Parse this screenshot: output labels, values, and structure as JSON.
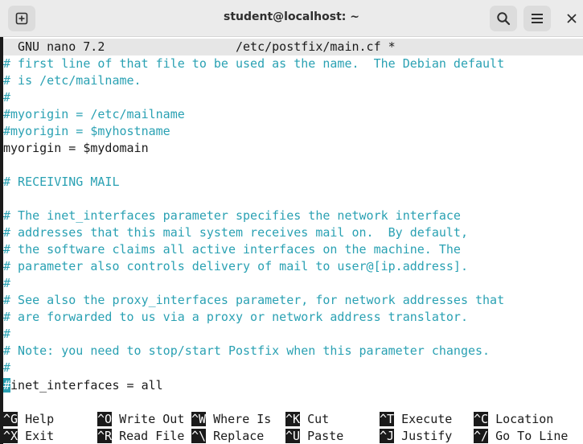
{
  "window": {
    "title": "student@localhost: ~",
    "icons": {
      "new_tab": "new-tab-icon",
      "search": "search-icon",
      "menu": "hamburger-menu-icon",
      "close": "close-icon"
    }
  },
  "nano": {
    "app_version": "GNU nano 7.2",
    "file_title": "/etc/postfix/main.cf *"
  },
  "lines": [
    {
      "text": "# first line of that file to be used as the name.  The Debian default",
      "kind": "comment"
    },
    {
      "text": "# is /etc/mailname.",
      "kind": "comment"
    },
    {
      "text": "#",
      "kind": "comment"
    },
    {
      "text": "#myorigin = /etc/mailname",
      "kind": "comment"
    },
    {
      "text": "#myorigin = $myhostname",
      "kind": "comment"
    },
    {
      "text": "myorigin = $mydomain",
      "kind": "code"
    },
    {
      "text": "",
      "kind": "code"
    },
    {
      "text": "# RECEIVING MAIL",
      "kind": "comment"
    },
    {
      "text": "",
      "kind": "code"
    },
    {
      "text": "# The inet_interfaces parameter specifies the network interface",
      "kind": "comment"
    },
    {
      "text": "# addresses that this mail system receives mail on.  By default,",
      "kind": "comment"
    },
    {
      "text": "# the software claims all active interfaces on the machine. The",
      "kind": "comment"
    },
    {
      "text": "# parameter also controls delivery of mail to user@[ip.address].",
      "kind": "comment"
    },
    {
      "text": "#",
      "kind": "comment"
    },
    {
      "text": "# See also the proxy_interfaces parameter, for network addresses that",
      "kind": "comment"
    },
    {
      "text": "# are forwarded to us via a proxy or network address translator.",
      "kind": "comment"
    },
    {
      "text": "#",
      "kind": "comment"
    },
    {
      "text": "# Note: you need to stop/start Postfix when this parameter changes.",
      "kind": "comment"
    },
    {
      "text": "#",
      "kind": "comment"
    }
  ],
  "cursor_line": {
    "cursor_char": "#",
    "rest": "inet_interfaces = all"
  },
  "shortcuts_row1": [
    {
      "key": "^G",
      "label": " Help"
    },
    {
      "key": "^O",
      "label": " Write Out"
    },
    {
      "key": "^W",
      "label": " Where Is"
    },
    {
      "key": "^K",
      "label": " Cut"
    },
    {
      "key": "^T",
      "label": " Execute"
    },
    {
      "key": "^C",
      "label": " Location"
    }
  ],
  "shortcuts_row2": [
    {
      "key": "^X",
      "label": " Exit"
    },
    {
      "key": "^R",
      "label": " Read File"
    },
    {
      "key": "^\\",
      "label": " Replace"
    },
    {
      "key": "^U",
      "label": " Paste"
    },
    {
      "key": "^J",
      "label": " Justify"
    },
    {
      "key": "^/",
      "label": " Go To Line"
    }
  ],
  "colors": {
    "comment": "#2aa1b3",
    "text": "#1a1a1a",
    "titlebar": "#ebebeb"
  }
}
